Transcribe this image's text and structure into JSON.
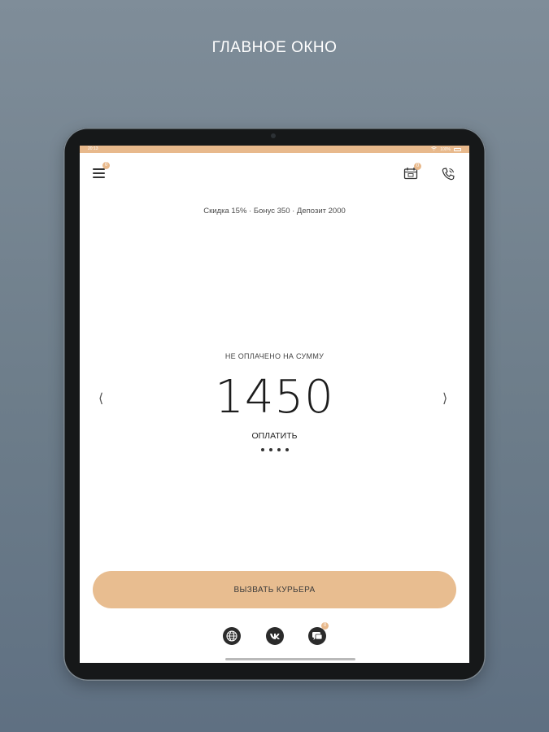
{
  "promo": {
    "title": "ГЛАВНОЕ ОКНО"
  },
  "status_bar": {
    "time": "20:13",
    "battery": "100%"
  },
  "header": {
    "menu_badge": "0",
    "calendar_badge": "0"
  },
  "account": {
    "summary": "Скидка 15% · Бонус 350 · Депозит 2000"
  },
  "payment": {
    "unpaid_label": "НЕ ОПЛАЧЕНО НА СУММУ",
    "amount": "1450",
    "pay_label": "ОПЛАТИТЬ",
    "prev_arrow": "⟨",
    "next_arrow": "⟩"
  },
  "actions": {
    "call_courier": "ВЫЗВАТЬ КУРЬЕРА"
  },
  "footer": {
    "chat_badge": "0"
  },
  "colors": {
    "accent": "#e8bd90",
    "status_bar": "#e8b98c",
    "text": "#1c1c1c"
  }
}
